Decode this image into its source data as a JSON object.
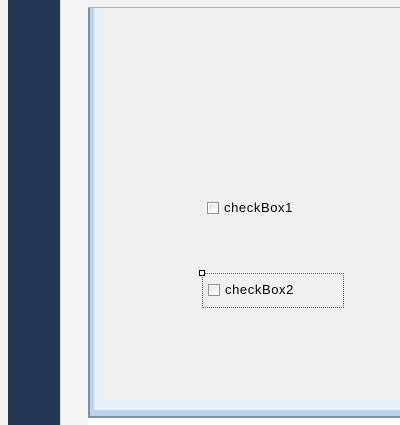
{
  "form": {
    "controls": [
      {
        "type": "checkbox",
        "label": "checkBox1",
        "checked": false,
        "selected": false
      },
      {
        "type": "checkbox",
        "label": "checkBox2",
        "checked": false,
        "selected": true
      }
    ]
  },
  "colors": {
    "left_panel": "#243652",
    "form_border": "#bcd3ec",
    "form_client": "#f0f0f0"
  }
}
